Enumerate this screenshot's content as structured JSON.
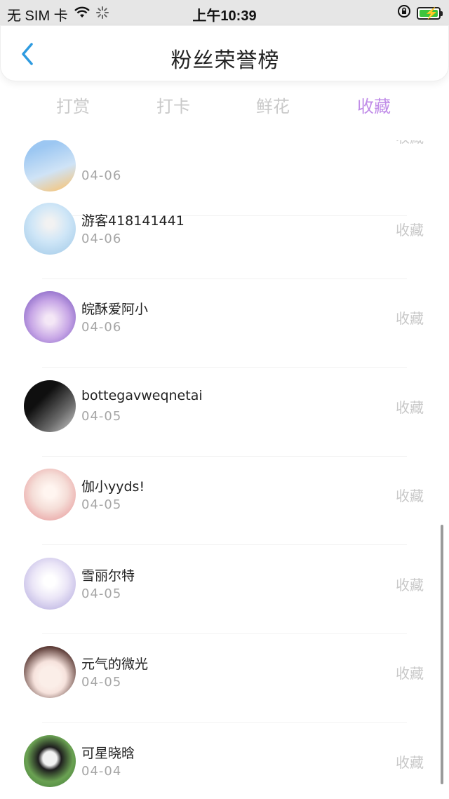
{
  "status_bar": {
    "carrier": "无 SIM 卡",
    "time": "上午10:39"
  },
  "header": {
    "title": "粉丝荣誉榜"
  },
  "tabs": [
    {
      "label": "打赏",
      "active": false
    },
    {
      "label": "打卡",
      "active": false
    },
    {
      "label": "鲜花",
      "active": false
    },
    {
      "label": "收藏",
      "active": true
    }
  ],
  "list": {
    "items": [
      {
        "name": "",
        "date": "04-06",
        "action": "收藏",
        "avatar_colors": [
          "#9cc7f2",
          "#f1c98a"
        ]
      },
      {
        "name": "游客418141441",
        "date": "04-06",
        "action": "收藏",
        "avatar_colors": [
          "#cfe6f7",
          "#eaf3fb"
        ]
      },
      {
        "name": "皖酥爱阿小",
        "date": "04-06",
        "action": "收藏",
        "avatar_colors": [
          "#c7a6e6",
          "#f7e39a"
        ]
      },
      {
        "name": "bottegavweqnetai",
        "date": "04-05",
        "action": "收藏",
        "avatar_colors": [
          "#1b1b1b",
          "#777777"
        ]
      },
      {
        "name": "伽小yyds!",
        "date": "04-05",
        "action": "收藏",
        "avatar_colors": [
          "#f5ded8",
          "#e9a3a3"
        ]
      },
      {
        "name": "雪丽尔特",
        "date": "04-05",
        "action": "收藏",
        "avatar_colors": [
          "#ebe6f7",
          "#b7aee0"
        ]
      },
      {
        "name": "元气的微光",
        "date": "04-05",
        "action": "收藏",
        "avatar_colors": [
          "#f6e2dc",
          "#5a3a35"
        ]
      },
      {
        "name": "可星晓晗",
        "date": "04-04",
        "action": "收藏",
        "avatar_colors": [
          "#6aa152",
          "#f2f2f2"
        ]
      }
    ]
  },
  "colors": {
    "accent_tab": "#c08ce8",
    "back_arrow": "#2f9be0"
  }
}
